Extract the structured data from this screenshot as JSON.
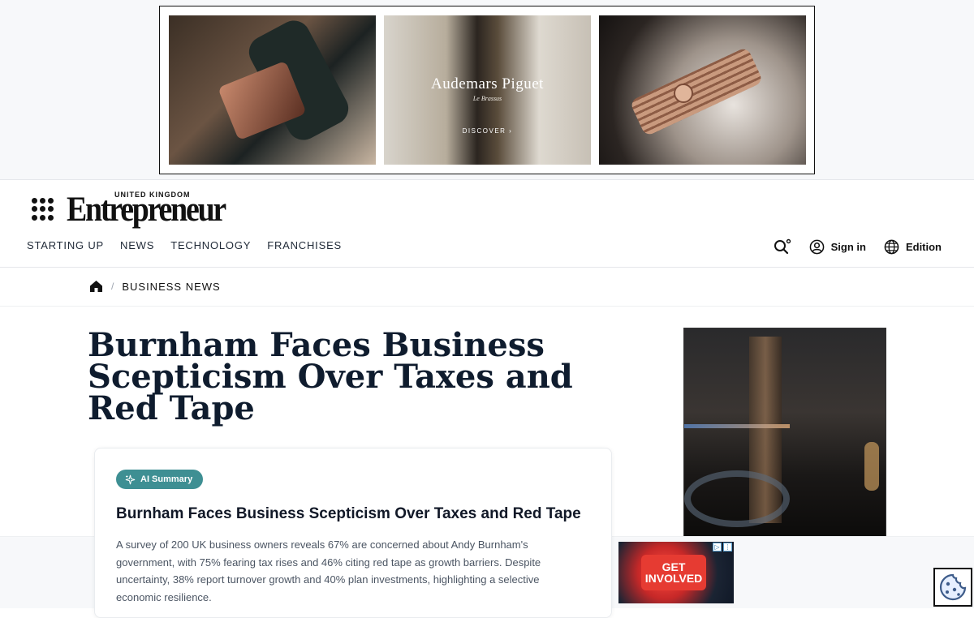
{
  "ads": {
    "top_banner": {
      "brand": "Audemars Piguet",
      "brand_sub": "Le Brassus",
      "cta": "DISCOVER ›"
    },
    "mini_banner": {
      "cta_line1": "GET",
      "cta_line2": "INVOLVED"
    }
  },
  "header": {
    "edition": "UNITED KINGDOM",
    "logo": "Entrepreneur",
    "nav": [
      "STARTING UP",
      "NEWS",
      "TECHNOLOGY",
      "FRANCHISES"
    ],
    "sign_in": "Sign in",
    "edition_label": "Edition"
  },
  "breadcrumb": {
    "section": "BUSINESS NEWS"
  },
  "article": {
    "headline": "Burnham Faces Business Scepticism Over Taxes and Red Tape",
    "summary": {
      "badge": "AI Summary",
      "title": "Burnham Faces Business Scepticism Over Taxes and Red Tape",
      "text": "A survey of 200 UK business owners reveals 67% are concerned about Andy Burnham's government, with 75% fearing tax rises and 46% citing red tape as growth barriers. Despite uncertainty, 38% report turnover growth and 40% plan investments, highlighting a selective economic resilience."
    }
  },
  "colors": {
    "accent_teal": "#3e8f93",
    "headline_navy": "#0f1c2e"
  }
}
